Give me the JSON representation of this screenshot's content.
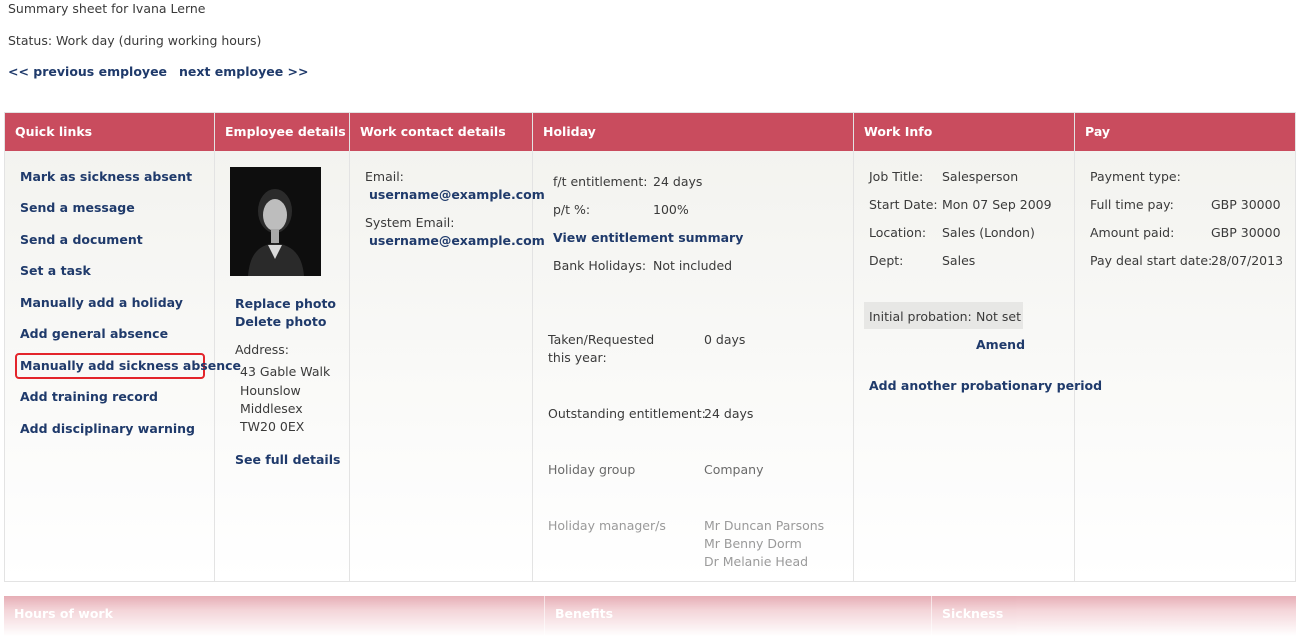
{
  "header": {
    "title": "Summary sheet for Ivana Lerne",
    "status_label": "Status:",
    "status_value": "Work day (during working hours)",
    "prev_label": "<< previous employee",
    "next_label": "next employee >>"
  },
  "columns": {
    "quick_links": "Quick links",
    "employee_details": "Employee details",
    "work_contact": "Work contact details",
    "holiday": "Holiday",
    "work_info": "Work Info",
    "pay": "Pay"
  },
  "quick_links": [
    "Mark as sickness absent",
    "Send a message",
    "Send a document",
    "Set a task",
    "Manually add a holiday",
    "Add general absence",
    "Manually add sickness absence",
    "Add training record",
    "Add disciplinary warning"
  ],
  "employee": {
    "replace_photo": "Replace photo",
    "delete_photo": "Delete photo",
    "address_label": "Address:",
    "address_lines": [
      "43 Gable Walk",
      "Hounslow",
      "Middlesex",
      "TW20 0EX"
    ],
    "see_full_details": "See full details"
  },
  "contact": {
    "email_label": "Email:",
    "email": "username@example.com",
    "system_email_label": "System Email:",
    "system_email": "username@example.com"
  },
  "holiday": {
    "ft_label": "f/t entitlement:",
    "ft_value": "24 days",
    "pt_label": "p/t %:",
    "pt_value": "100%",
    "view_summary": "View entitlement summary",
    "bank_label": "Bank Holidays:",
    "bank_value": "Not included",
    "taken_label_1": "Taken/Requested",
    "taken_label_2": "this year:",
    "taken_value": "0 days",
    "outstanding_label": "Outstanding entitlement:",
    "outstanding_value": "24 days",
    "group_label": "Holiday group",
    "group_value": "Company",
    "managers_label": "Holiday manager/s",
    "managers": [
      "Mr Duncan Parsons",
      "Mr Benny Dorm",
      "Dr Melanie Head"
    ]
  },
  "work_info": {
    "job_label": "Job Title:",
    "job_value": "Salesperson",
    "start_label": "Start Date:",
    "start_value": "Mon 07 Sep 2009",
    "location_label": "Location:",
    "location_value": "Sales (London)",
    "dept_label": "Dept:",
    "dept_value": "Sales",
    "probation_label": "Initial probation:",
    "probation_value": "Not set",
    "amend": "Amend",
    "add_probation": "Add another probationary period"
  },
  "pay": {
    "type_label": "Payment type:",
    "fulltime_label": "Full time pay:",
    "fulltime_value": "GBP 30000",
    "paid_label": "Amount paid:",
    "paid_value": "GBP 30000",
    "deal_label": "Pay deal start date:",
    "deal_value": "28/07/2013"
  },
  "bottom_sections": [
    "Hours of work",
    "Benefits",
    "Sickness"
  ],
  "colors": {
    "header_bg": "#c94c5e",
    "link": "#1f3a6b",
    "highlight": "#e3242b"
  }
}
